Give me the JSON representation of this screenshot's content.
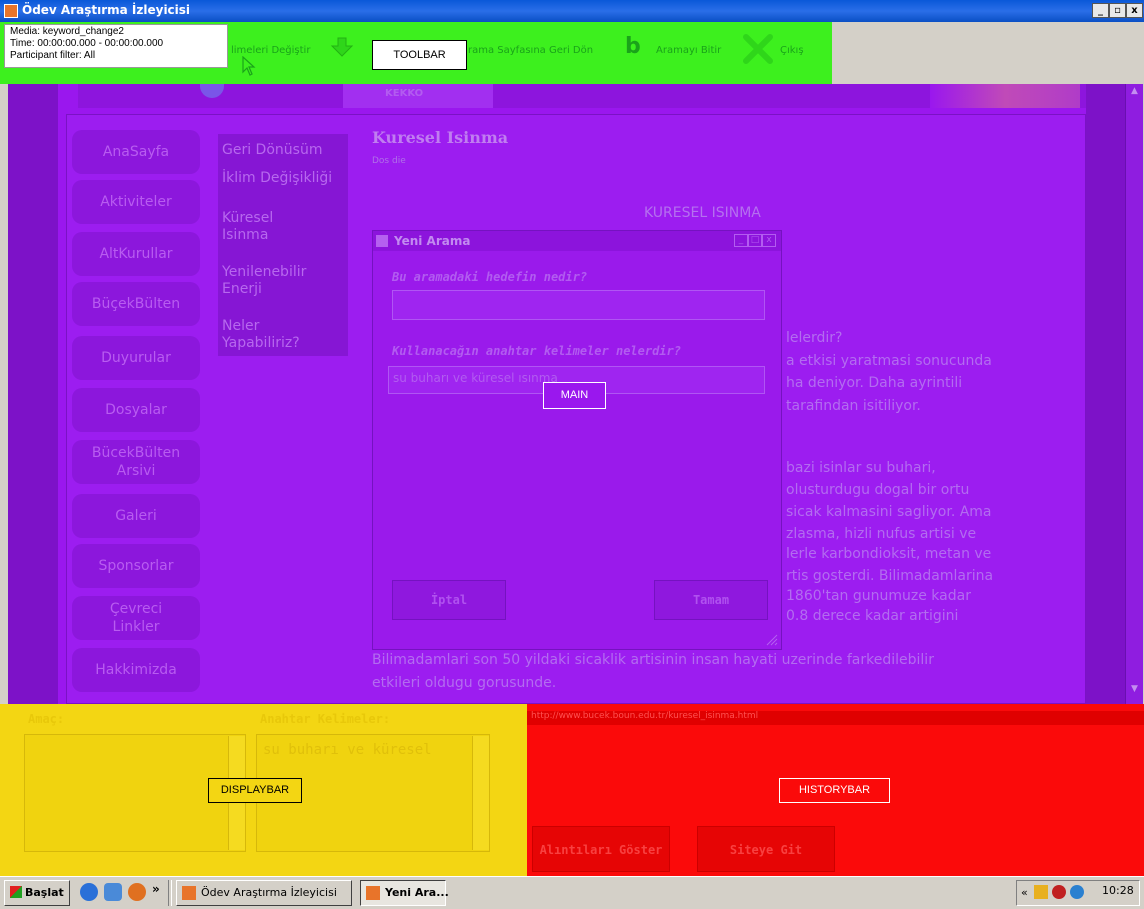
{
  "window": {
    "title": "Ödev Araştırma İzleyicisi",
    "controls": [
      "_",
      "▫",
      "x"
    ]
  },
  "media_info": {
    "line1": "Media: keyword_change2",
    "line2": "Time: 00:00:00.000 - 00:00:00.000",
    "line3": "Participant filter: All"
  },
  "toolbar": {
    "item1": "limeleri Değiştir",
    "item2": "rama Sayfasına Geri Dön",
    "item3": "Aramayı Bitir",
    "item4": "Çıkış",
    "aoi_label": "TOOLBAR"
  },
  "site": {
    "header_tab": "KEKKO"
  },
  "nav": {
    "items": [
      "AnaSayfa",
      "Aktiviteler",
      "AltKurullar",
      "BüçekBülten",
      "Duyurular",
      "Dosyalar"
    ],
    "archive": [
      "BücekBülten",
      "Arsivi"
    ],
    "items2": [
      "Galeri",
      "Sponsorlar"
    ],
    "links": [
      "Çevreci",
      "Linkler"
    ],
    "about": "Hakkimizda"
  },
  "sub_nav": {
    "item1": "Geri Dönüsüm",
    "item2": "İklim Değişikliği",
    "item3a": "Küresel",
    "item3b": "Isinma",
    "item4a": "Yenilenebilir",
    "item4b": "Enerji",
    "item5a": "Neler",
    "item5b": "Yapabiliriz?"
  },
  "page": {
    "title": "Kuresel Isinma",
    "subtitle": "Dos die",
    "heading": "KURESEL ISINMA",
    "lines": [
      "lelerdir?",
      "a etkisi yaratmasi sonucunda",
      "ha deniyor. Daha ayrintili",
      "tarafindan isitiliyor.",
      "bazi isinlar su buhari,",
      "olusturdugu dogal bir ortu",
      "sicak kalmasini sagliyor. Ama",
      "zlasma, hizli nufus artisi ve",
      "lerle karbondioksit, metan ve",
      "rtis gosterdi. Bilimadamlarina",
      "1860'tan gunumuze kadar",
      "0.8 derece kadar artigini"
    ],
    "footer1": "Bilimadamlari son 50 yildaki sicaklik artisinin insan hayati uzerinde farkedilebilir",
    "footer2": "etkileri oldugu gorusunde."
  },
  "dialog": {
    "title": "Yeni Arama",
    "q1": "Bu aramadaki hedefin nedir?",
    "q1_value": "",
    "q2": "Kullanacağın anahtar kelimeler nelerdir?",
    "q2_value": "su buharı ve küresel ısınma",
    "cancel": "İptal",
    "ok": "Tamam",
    "aoi_label": "MAIN"
  },
  "displaybar": {
    "purpose_label": "Amaç:",
    "keywords_label": "Anahtar Kelimeler:",
    "keywords_value": "su buharı ve küresel",
    "aoi_label": "DISPLAYBAR"
  },
  "historybar": {
    "url": "http://www.bucek.boun.edu.tr/kuresel_isinma.html",
    "show_quotes": "Alıntıları Göster",
    "go_site": "Siteye Git",
    "aoi_label": "HISTORYBAR"
  },
  "taskbar": {
    "start": "Başlat",
    "task1": "Ödev Araştırma İzleyicisi",
    "task2": "Yeni Ara...",
    "clock": "10:28"
  },
  "colors": {
    "toolbar_aoi": "#3df01e",
    "main_aoi": "#9a17ee",
    "displaybar_aoi": "#f3d613",
    "historybar_aoi": "#fb0a0a"
  }
}
